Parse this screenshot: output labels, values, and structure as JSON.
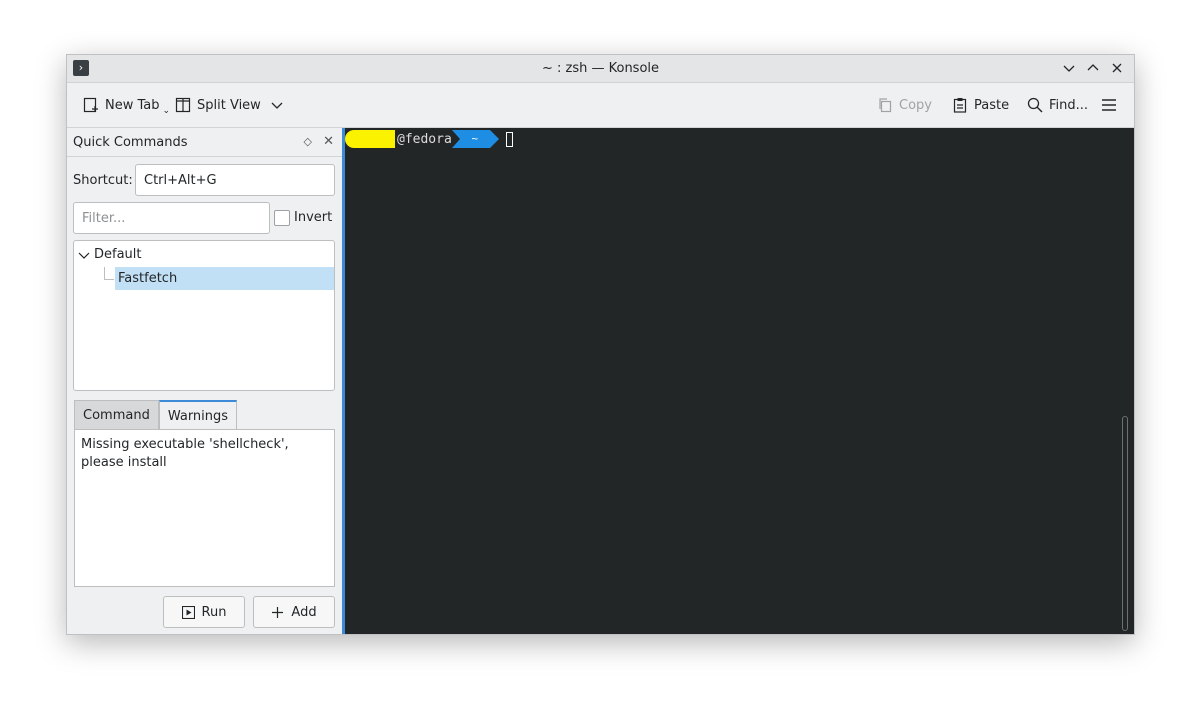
{
  "window": {
    "title": "~ : zsh — Konsole",
    "app_icon": "terminal-icon"
  },
  "toolbar": {
    "new_tab": "New Tab",
    "split_view": "Split View",
    "copy": "Copy",
    "paste": "Paste",
    "find": "Find...",
    "menu_icon": "hamburger-icon"
  },
  "quick_commands": {
    "title": "Quick Commands",
    "shortcut_label": "Shortcut:",
    "shortcut_value": "Ctrl+Alt+G",
    "filter_placeholder": "Filter...",
    "invert_label": "Invert",
    "tree": {
      "group": "Default",
      "items": [
        "Fastfetch"
      ]
    },
    "tabs": [
      "Command",
      "Warnings"
    ],
    "active_tab": "Warnings",
    "warning_text": "Missing executable 'shellcheck', please install",
    "run_label": "Run",
    "add_label": "Add"
  },
  "terminal": {
    "host": "@fedora",
    "path": "~"
  },
  "colors": {
    "accent": "#3d8bd8",
    "terminal_bg": "#232627",
    "prompt_user_bg": "#fbf200",
    "prompt_path_bg": "#1d8ee3",
    "selection": "#c2e0f5"
  }
}
